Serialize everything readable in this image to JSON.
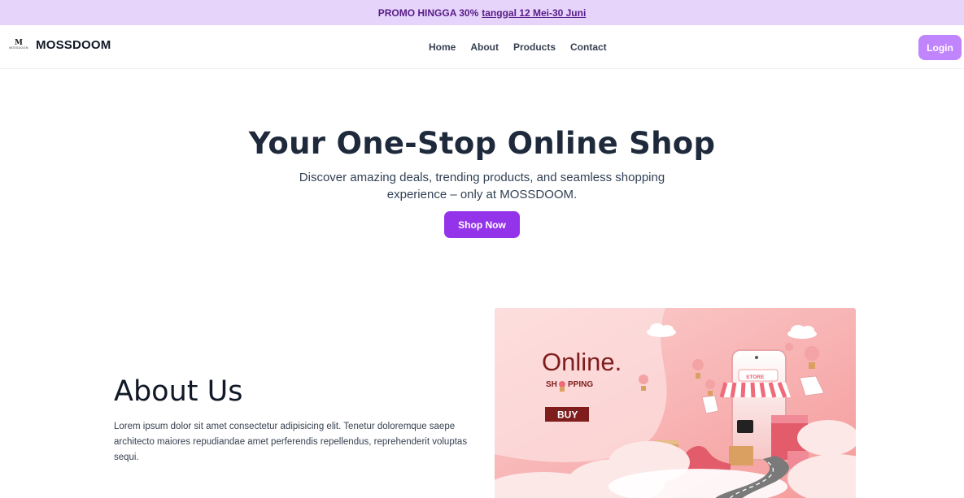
{
  "promo": {
    "text": "PROMO HINGGA 30%",
    "link": "tanggal 12 Mei-30 Juni"
  },
  "navbar": {
    "logo_mark": "M",
    "logo_text": "MOSSDOOM",
    "brand": "MOSSDOOM",
    "links": [
      "Home",
      "About",
      "Products",
      "Contact"
    ],
    "login": "Login"
  },
  "hero": {
    "title": "Your One-Stop Online Shop",
    "subtitle": "Discover amazing deals, trending products, and seamless shopping experience – only at MOSSDOOM.",
    "cta": "Shop Now"
  },
  "about": {
    "title": "About Us",
    "body": "Lorem ipsum dolor sit amet consectetur adipisicing elit. Tenetur doloremque saepe architecto maiores repudiandae amet perferendis repellendus, reprehenderit voluptas sequi.",
    "image": {
      "headline": "Online.",
      "sub_before": "SH",
      "sub_after": "PPING",
      "buy": "BUY",
      "store": "STORE"
    }
  },
  "colors": {
    "promo_bg": "#e6d4fb",
    "accent": "#9333ea",
    "login_bg": "#c084fc",
    "heading": "#1e293b"
  }
}
